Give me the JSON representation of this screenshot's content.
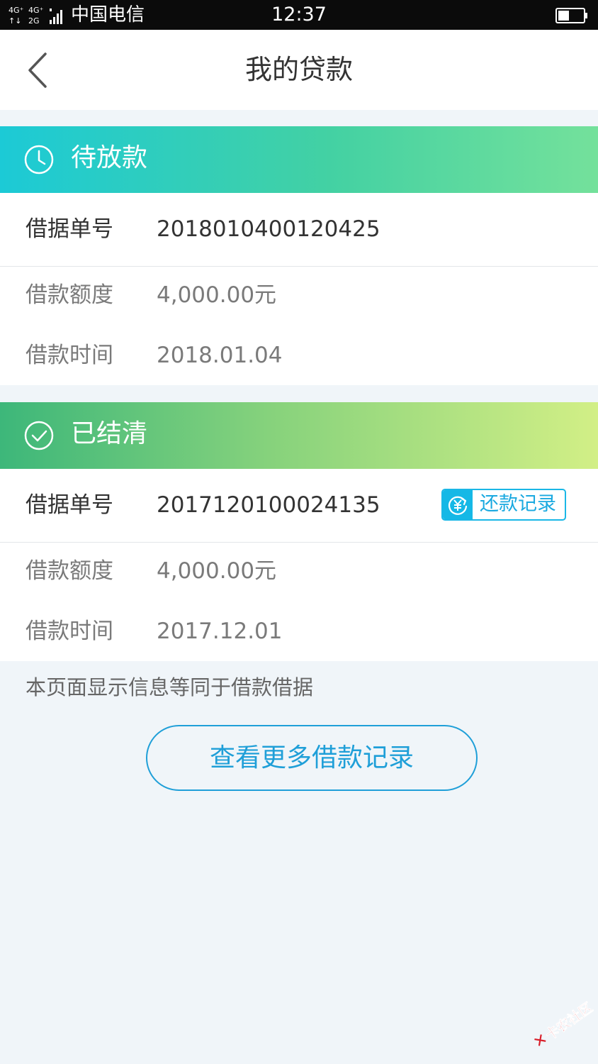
{
  "status_bar": {
    "network": "4G⁺ 4G⁺ 2G",
    "carrier": "中国电信",
    "time": "12:37",
    "battery_level": 0.45
  },
  "header": {
    "title": "我的贷款"
  },
  "sections": [
    {
      "status": "待放款",
      "status_icon": "clock-icon",
      "loan_no_label": "借据单号",
      "loan_no": "2018010400120425",
      "amount_label": "借款额度",
      "amount": "4,000.00元",
      "date_label": "借款时间",
      "date": "2018.01.04"
    },
    {
      "status": "已结清",
      "status_icon": "check-circle-icon",
      "loan_no_label": "借据单号",
      "loan_no": "2017120100024135",
      "amount_label": "借款额度",
      "amount": "4,000.00元",
      "date_label": "借款时间",
      "date": "2017.12.01",
      "repay_button_label": "还款记录"
    }
  ],
  "footnote": "本页面显示信息等同于借款借据",
  "more_button_label": "查看更多借款记录",
  "watermark": "卡农社区",
  "colors": {
    "accent": "#1f9fd8",
    "pending_banner_start": "#1ccad6",
    "pending_banner_end": "#74e19b",
    "settled_banner_start": "#3db77a",
    "settled_banner_end": "#d2ef86"
  }
}
